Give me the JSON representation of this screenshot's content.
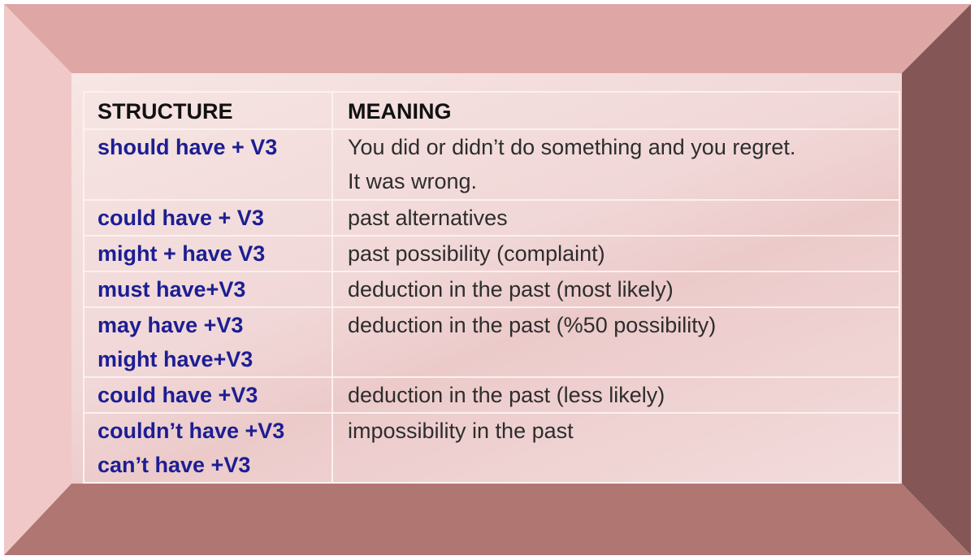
{
  "colors": {
    "structure_text": "#1c1e93",
    "meaning_text": "#2d2d2d",
    "bevel_top": "#dfa6a6",
    "bevel_left": "#f0c8c8",
    "bevel_right": "#845656",
    "bevel_bottom": "#b07672"
  },
  "table": {
    "headers": [
      "STRUCTURE",
      "MEANING"
    ],
    "rows": [
      {
        "structure": [
          "should have + V3"
        ],
        "meaning": [
          "You did or didn’t do something and you regret.",
          "It was wrong."
        ]
      },
      {
        "structure": [
          "could have + V3"
        ],
        "meaning": [
          "past alternatives"
        ]
      },
      {
        "structure": [
          "might + have  V3"
        ],
        "meaning": [
          "past possibility (complaint)"
        ]
      },
      {
        "structure": [
          "must have+V3"
        ],
        "meaning": [
          "deduction in the past (most likely)"
        ]
      },
      {
        "structure": [
          "may have +V3",
          "might have+V3"
        ],
        "meaning": [
          "deduction in the past (%50 possibility)"
        ]
      },
      {
        "structure": [
          "could have +V3"
        ],
        "meaning": [
          "deduction in the past (less likely)"
        ]
      },
      {
        "structure": [
          "couldn’t have +V3",
          "can’t have +V3"
        ],
        "meaning": [
          "impossibility in the past"
        ]
      }
    ]
  }
}
